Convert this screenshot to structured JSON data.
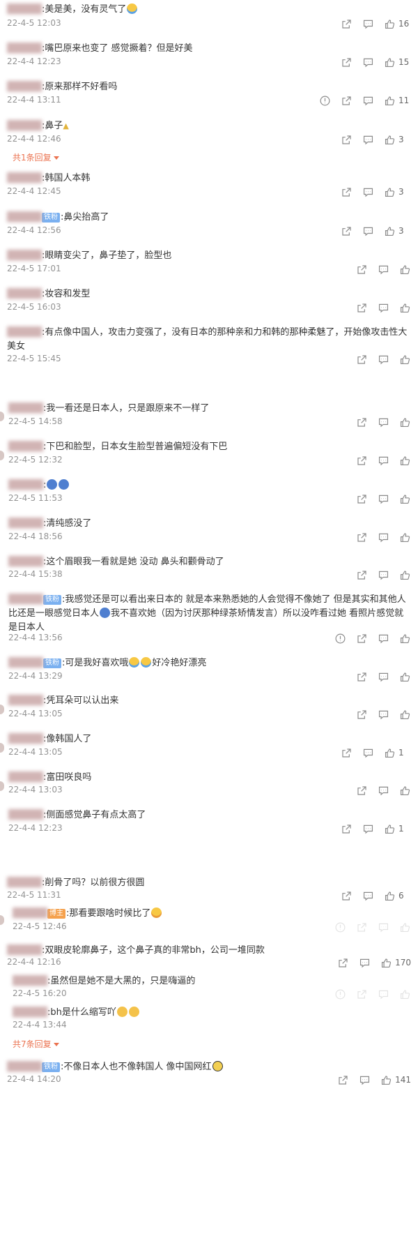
{
  "comments": [
    {
      "segments": [
        {
          "t": "text",
          "v": "美是美，没有灵气了"
        },
        {
          "t": "emoji",
          "v": "crying-emoji"
        }
      ],
      "time": "22-4-5 12:03",
      "likes": "16",
      "has_report": false
    },
    {
      "segments": [
        {
          "t": "text",
          "v": "嘴巴原来也变了 感觉撅着？但是好美"
        }
      ],
      "time": "22-4-4 12:23",
      "likes": "15",
      "has_report": false
    },
    {
      "segments": [
        {
          "t": "text",
          "v": "原来那样不好看吗"
        }
      ],
      "time": "22-4-4 13:11",
      "likes": "11",
      "has_report": true
    },
    {
      "segments": [
        {
          "t": "text",
          "v": "鼻子"
        }
      ],
      "time": "22-4-4 12:46",
      "likes": "3",
      "has_report": false
    },
    {
      "segments": [
        {
          "t": "text",
          "v": "韩国人本韩"
        }
      ],
      "time": "22-4-4 12:45",
      "likes": "3",
      "has_report": false
    },
    {
      "segments": [
        {
          "t": "badge",
          "v": "铁粉"
        },
        {
          "t": "text",
          "v": "鼻尖抬高了"
        }
      ],
      "time": "22-4-4 12:56",
      "likes": "3",
      "has_report": false
    },
    {
      "segments": [
        {
          "t": "text",
          "v": "眼睛变尖了，鼻子垫了，脸型也"
        }
      ],
      "time": "22-4-5 17:01",
      "likes": "",
      "has_report": false
    },
    {
      "segments": [
        {
          "t": "text",
          "v": "妆容和发型"
        }
      ],
      "time": "22-4-5 16:03",
      "likes": "",
      "has_report": false
    },
    {
      "segments": [
        {
          "t": "text",
          "v": "有点像中国人，攻击力变强了，没有日本的那种亲和力和韩的那种柔魅了，开始像攻击性大美女"
        }
      ],
      "time": "22-4-5 15:45",
      "likes": "",
      "has_report": false
    },
    {
      "segments": [
        {
          "t": "text",
          "v": "我一看还是日本人，只是跟原来不一样了"
        }
      ],
      "time": "22-4-5 14:58",
      "likes": "",
      "has_report": false
    },
    {
      "segments": [
        {
          "t": "text",
          "v": "下巴和脸型，日本女生脸型普遍偏短没有下巴"
        }
      ],
      "time": "22-4-5 12:32",
      "likes": "",
      "has_report": false
    },
    {
      "segments": [
        {
          "t": "emoji",
          "v": "blue-emoji"
        },
        {
          "t": "emoji",
          "v": "blue-emoji"
        }
      ],
      "time": "22-4-5 11:53",
      "likes": "",
      "has_report": false
    },
    {
      "segments": [
        {
          "t": "text",
          "v": "清纯感没了"
        }
      ],
      "time": "22-4-4 18:56",
      "likes": "",
      "has_report": false
    },
    {
      "segments": [
        {
          "t": "text",
          "v": "这个眉眼我一看就是她 没动 鼻头和颧骨动了"
        }
      ],
      "time": "22-4-4 15:38",
      "likes": "",
      "has_report": false
    },
    {
      "segments": [
        {
          "t": "badge",
          "v": "铁粉"
        },
        {
          "t": "text",
          "v": "我感觉还是可以看出来日本的 就是本来熟悉她的人会觉得不像她了 但是其实和其他人比还是一眼感觉日本人"
        },
        {
          "t": "emoji",
          "v": "sweat-emoji"
        },
        {
          "t": "text",
          "v": "我不喜欢她（因为讨厌那种绿茶矫情发言）所以没咋看过她 看照片感觉就是日本人"
        }
      ],
      "time": "22-4-4 13:56",
      "likes": "",
      "has_report": true
    },
    {
      "segments": [
        {
          "t": "badge",
          "v": "铁粉"
        },
        {
          "t": "text",
          "v": "可是我好喜欢哦"
        },
        {
          "t": "emoji",
          "v": "crying-emoji"
        },
        {
          "t": "emoji",
          "v": "crying-emoji"
        },
        {
          "t": "text",
          "v": "好冷艳好漂亮"
        }
      ],
      "time": "22-4-4 13:29",
      "likes": "",
      "has_report": false
    },
    {
      "segments": [
        {
          "t": "text",
          "v": "凭耳朵可以认出来"
        }
      ],
      "time": "22-4-4 13:05",
      "likes": "",
      "has_report": false
    },
    {
      "segments": [
        {
          "t": "text",
          "v": "像韩国人了"
        }
      ],
      "time": "22-4-4 13:05",
      "likes": "1",
      "has_report": false
    },
    {
      "segments": [
        {
          "t": "text",
          "v": "富田咲良吗"
        }
      ],
      "time": "22-4-4 13:03",
      "likes": "",
      "has_report": false
    },
    {
      "segments": [
        {
          "t": "text",
          "v": "侧面感觉鼻子有点太高了"
        }
      ],
      "time": "22-4-4 12:23",
      "likes": "1",
      "has_report": false
    },
    {
      "segments": [
        {
          "t": "text",
          "v": "削骨了吗？以前很方很圆"
        }
      ],
      "time": "22-4-5 11:31",
      "likes": "6",
      "has_report": false
    },
    {
      "segments": [
        {
          "t": "badge",
          "v": "博主"
        },
        {
          "t": "text",
          "v": "那看要跟啥时候比了"
        },
        {
          "t": "emoji",
          "v": "smile-emoji"
        }
      ],
      "time": "22-4-5 12:46",
      "likes": "",
      "has_report": true,
      "dim": true
    },
    {
      "segments": [
        {
          "t": "text",
          "v": "双眼皮轮廓鼻子，这个鼻子真的非常bh，公司一堆同款"
        }
      ],
      "time": "22-4-4 12:16",
      "likes": "170",
      "has_report": false
    },
    {
      "segments": [
        {
          "t": "text",
          "v": "虽然但是她不是大黑的，只是嗨逼的"
        }
      ],
      "time": "22-4-5 16:20",
      "likes": "",
      "has_report": true,
      "dim": true
    },
    {
      "segments": [
        {
          "t": "text",
          "v": "bh是什么缩写吖"
        },
        {
          "t": "emoji",
          "v": "wow-emoji"
        },
        {
          "t": "emoji",
          "v": "wow-emoji"
        }
      ],
      "time": "22-4-4 13:44",
      "likes": "",
      "has_report": false,
      "no_actions": true
    },
    {
      "segments": [
        {
          "t": "badge",
          "v": "铁粉"
        },
        {
          "t": "text",
          "v": "不像日本人也不像韩国人 像中国网红"
        },
        {
          "t": "emoji",
          "v": "glasses-emoji"
        }
      ],
      "time": "22-4-4 14:20",
      "likes": "141",
      "has_report": false
    }
  ],
  "reply_links": [
    {
      "label": "共1条回复"
    },
    {
      "label": "共7条回复"
    }
  ],
  "colors": {
    "accent": "#eb7350",
    "text": "#333333",
    "meta": "#939393",
    "fan_badge": "#7ab0f0",
    "author_badge": "#f5a14d"
  }
}
